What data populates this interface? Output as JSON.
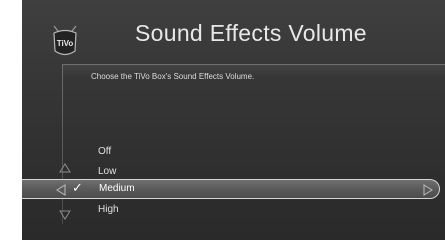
{
  "header": {
    "logo_text": "TiVo",
    "title": "Sound Effects Volume"
  },
  "main": {
    "instruction": "Choose the TiVo Box's Sound Effects Volume.",
    "options": [
      {
        "label": "Off",
        "selected": false
      },
      {
        "label": "Low",
        "selected": false
      },
      {
        "label": "Medium",
        "selected": true
      },
      {
        "label": "High",
        "selected": false
      }
    ],
    "check_glyph": "✓"
  },
  "icons": {
    "logo": "tivo-logo",
    "left": "left-arrow-icon",
    "right": "right-arrow-icon",
    "up": "up-arrow-icon",
    "down": "down-arrow-icon",
    "check": "checkmark-icon"
  },
  "colors": {
    "background": "#363636",
    "text": "#e0e0e0",
    "selection_border": "#d6d6d6"
  }
}
